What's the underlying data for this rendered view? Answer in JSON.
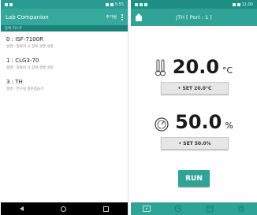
{
  "left": {
    "status_time": "5:55",
    "app_title": "Lab Companion",
    "action_label": "추가됨",
    "section_header": "등록 리스트",
    "devices": [
      {
        "name": "0 : ISF-7100R",
        "desc": "설명 : 종류의 시 장비 설명 설정"
      },
      {
        "name": "1 : CLG3-70",
        "desc": "설명 : 종류의 시 장비 설명 설정"
      },
      {
        "name": "3 : TH",
        "desc": "설명 : 연구실 항온항습기"
      }
    ]
  },
  "right": {
    "status_time": "11:00",
    "title": "JTH [ Port : 1 ]",
    "temperature": {
      "value": "20.0",
      "unit": "°C",
      "set_label": "• SET 20.0°C"
    },
    "humidity": {
      "value": "50.0",
      "unit": "%",
      "set_label": "• SET 50.0%"
    },
    "run_label": "RUN",
    "tabs": [
      "play-icon",
      "clock-icon",
      "calendar-icon",
      "settings-icon"
    ]
  },
  "colors": {
    "primary": "#2ea396",
    "primary_dark": "#1f8f84",
    "subheader": "#1b8379"
  }
}
